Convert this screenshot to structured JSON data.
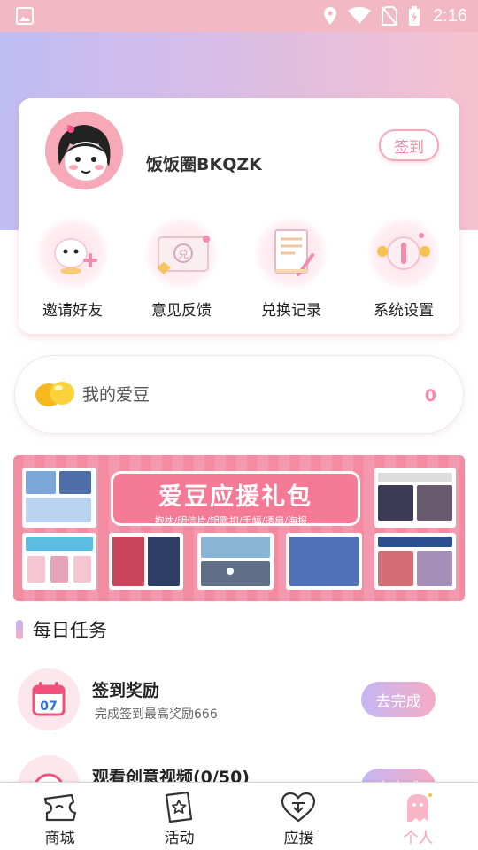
{
  "status_bar": {
    "time": "2:16"
  },
  "profile": {
    "username": "饭饭圈BKQZK",
    "checkin_label": "签到"
  },
  "quick_actions": [
    {
      "label": "邀请好友",
      "icon": "invite-friends-icon"
    },
    {
      "label": "意见反馈",
      "icon": "feedback-icon"
    },
    {
      "label": "兑换记录",
      "icon": "exchange-record-icon"
    },
    {
      "label": "系统设置",
      "icon": "settings-icon"
    }
  ],
  "idol_bean": {
    "label": "我的爱豆",
    "count": "0"
  },
  "banner": {
    "title": "爱豆应援礼包",
    "subtitle": "抱枕/明信片/钥匙扣/手幅/透扇/海报..."
  },
  "daily_tasks": {
    "title": "每日任务",
    "items": [
      {
        "title": "签到奖励",
        "desc": "完成签到最高奖励666",
        "button": "去完成",
        "calendar_day": "07"
      },
      {
        "title": "观看创意视频(0/50)",
        "desc": "",
        "button": "去完成"
      }
    ]
  },
  "tab_bar": {
    "tabs": [
      {
        "label": "商城",
        "icon": "shop-ticket-icon"
      },
      {
        "label": "活动",
        "icon": "activity-star-icon"
      },
      {
        "label": "应援",
        "icon": "support-heart-icon"
      },
      {
        "label": "个人",
        "icon": "profile-ghost-icon"
      }
    ],
    "active_tab": "个人",
    "active_color": "#f5a3b6"
  },
  "colors": {
    "accent_pink": "#f48aa6",
    "hero_gradient_start": "#bfbdf4",
    "hero_gradient_end": "#f6c2cf",
    "status_bar": "#f2b8c4"
  }
}
